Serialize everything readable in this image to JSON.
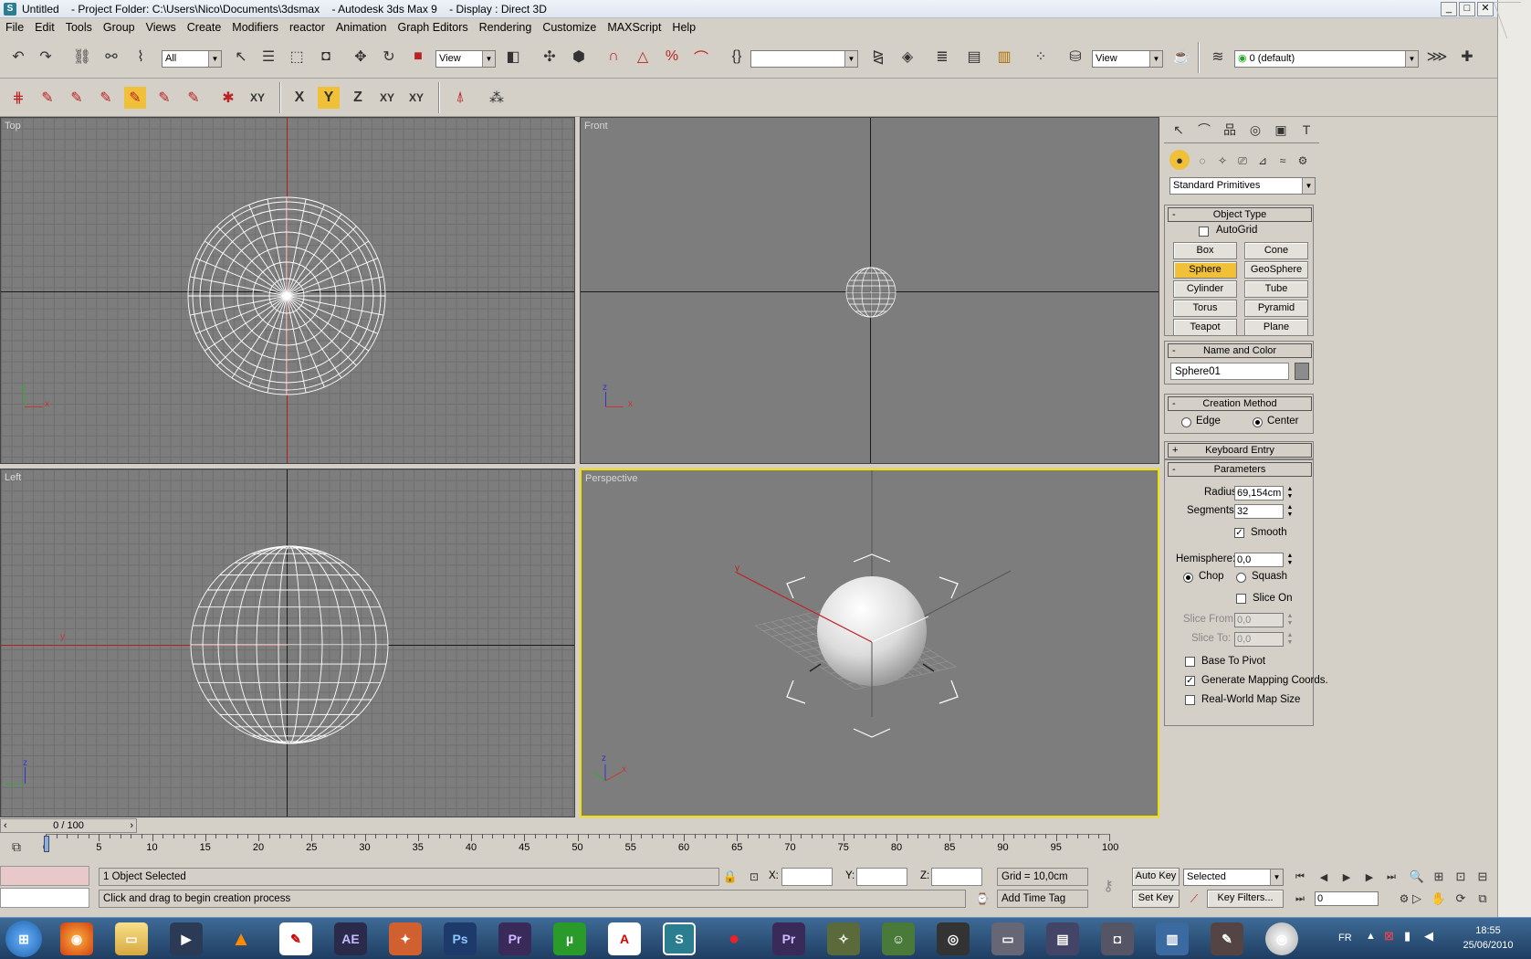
{
  "window": {
    "title": "Untitled    - Project Folder: C:\\Users\\Nico\\Documents\\3dsmax    - Autodesk 3ds Max 9    - Display : Direct 3D",
    "app_icon": "S"
  },
  "menu": [
    "File",
    "Edit",
    "Tools",
    "Group",
    "Views",
    "Create",
    "Modifiers",
    "reactor",
    "Animation",
    "Graph Editors",
    "Rendering",
    "Customize",
    "MAXScript",
    "Help"
  ],
  "toolbar": {
    "selection_filter": "All",
    "ref_coord": "View",
    "named_selection": "",
    "render_view": "View",
    "layer": "0 (default)"
  },
  "axis_toolbar": {
    "x": "X",
    "y": "Y",
    "z": "Z",
    "xy": "XY",
    "xy2": "XY"
  },
  "viewports": {
    "top": "Top",
    "front": "Front",
    "left": "Left",
    "perspective": "Perspective",
    "axis_labels": {
      "x": "x",
      "y": "y",
      "z": "z"
    }
  },
  "command_panel": {
    "category": "Standard Primitives",
    "object_type": {
      "header": "Object Type",
      "autogrid": "AutoGrid",
      "buttons": [
        "Box",
        "Cone",
        "Sphere",
        "GeoSphere",
        "Cylinder",
        "Tube",
        "Torus",
        "Pyramid",
        "Teapot",
        "Plane"
      ],
      "active": "Sphere"
    },
    "name_color": {
      "header": "Name and Color",
      "name": "Sphere01",
      "color": "#8c8c8c"
    },
    "creation_method": {
      "header": "Creation Method",
      "edge": "Edge",
      "center": "Center",
      "selected": "Center"
    },
    "keyboard_entry": "Keyboard Entry",
    "parameters": {
      "header": "Parameters",
      "radius_label": "Radius:",
      "radius": "69,154cm",
      "segments_label": "Segments:",
      "segments": "32",
      "smooth": "Smooth",
      "smooth_checked": true,
      "hemisphere_label": "Hemisphere:",
      "hemisphere": "0,0",
      "chop": "Chop",
      "squash": "Squash",
      "slice_on": "Slice On",
      "slice_from_label": "Slice From:",
      "slice_from": "0,0",
      "slice_to_label": "Slice To:",
      "slice_to": "0,0",
      "base_to_pivot": "Base To Pivot",
      "gen_mapping": "Generate Mapping Coords.",
      "gen_mapping_checked": true,
      "real_world": "Real-World Map Size"
    }
  },
  "timeline": {
    "frame": "0 / 100",
    "ticks": [
      "0",
      "5",
      "10",
      "15",
      "20",
      "25",
      "30",
      "35",
      "40",
      "45",
      "50",
      "55",
      "60",
      "65",
      "70",
      "75",
      "80",
      "85",
      "90",
      "95",
      "100"
    ]
  },
  "status": {
    "selected": "1 Object Selected",
    "prompt": "Click and drag to begin creation process",
    "x_label": "X:",
    "y_label": "Y:",
    "z_label": "Z:",
    "grid": "Grid = 10,0cm",
    "add_time_tag": "Add Time Tag",
    "auto_key": "Auto Key",
    "set_key": "Set Key",
    "key_mode": "Selected",
    "key_filters": "Key Filters...",
    "frame_field": "0"
  },
  "taskbar": {
    "apps": [
      "AE",
      "Ps",
      "Pr",
      "µ",
      "Pr"
    ],
    "lang": "FR",
    "time": "18:55",
    "date": "25/06/2010"
  }
}
